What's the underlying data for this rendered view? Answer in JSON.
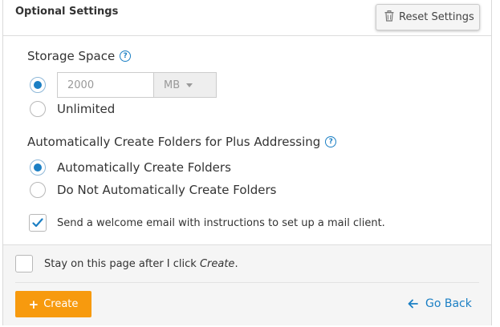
{
  "header": {
    "title": "Optional Settings",
    "reset_label": "Reset Settings",
    "reset_icon": "trash-icon"
  },
  "storage": {
    "label": "Storage Space",
    "help_glyph": "?",
    "input_value": "2000",
    "unit": "MB",
    "selected": "limited",
    "unlimited_label": "Unlimited"
  },
  "folders": {
    "label": "Automatically Create Folders for Plus Addressing",
    "help_glyph": "?",
    "option_auto": "Automatically Create Folders",
    "option_none": "Do Not Automatically Create Folders",
    "selected": "auto"
  },
  "welcome_email": {
    "label": "Send a welcome email with instructions to set up a mail client.",
    "checked": true
  },
  "footer": {
    "stay_prefix": "Stay on this page after I click ",
    "stay_emphasis": "Create",
    "stay_suffix": ".",
    "stay_checked": false,
    "create_label": "Create",
    "create_icon": "plus-icon",
    "go_back_label": "Go Back",
    "go_back_icon": "arrow-left-icon"
  },
  "colors": {
    "accent": "#1b7fc4",
    "create_button": "#f79a0e"
  }
}
